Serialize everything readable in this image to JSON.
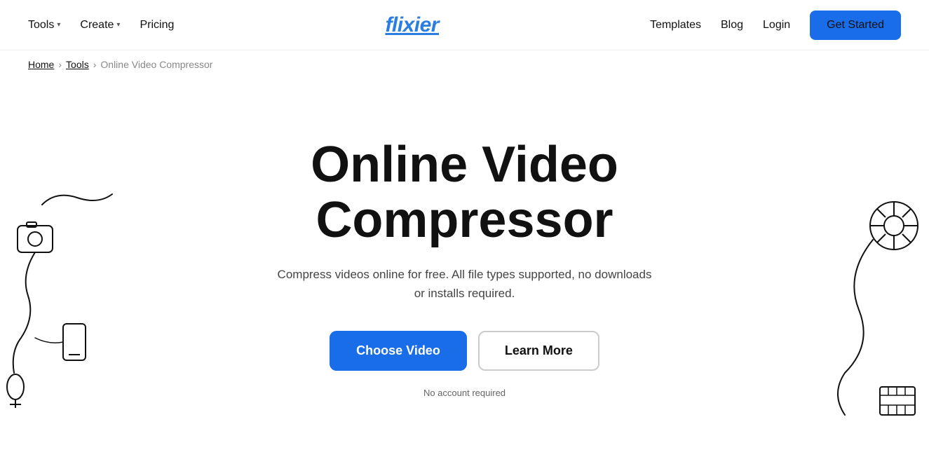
{
  "nav": {
    "logo": "flixier",
    "left": {
      "tools_label": "Tools",
      "create_label": "Create",
      "pricing_label": "Pricing"
    },
    "right": {
      "templates_label": "Templates",
      "blog_label": "Blog",
      "login_label": "Login",
      "get_started_label": "Get Started"
    }
  },
  "breadcrumb": {
    "home": "Home",
    "tools": "Tools",
    "current": "Online Video Compressor"
  },
  "hero": {
    "title": "Online Video Compressor",
    "subtitle": "Compress videos online for free. All file types supported, no downloads or installs required.",
    "choose_video": "Choose Video",
    "learn_more": "Learn More",
    "no_account": "No account required"
  }
}
